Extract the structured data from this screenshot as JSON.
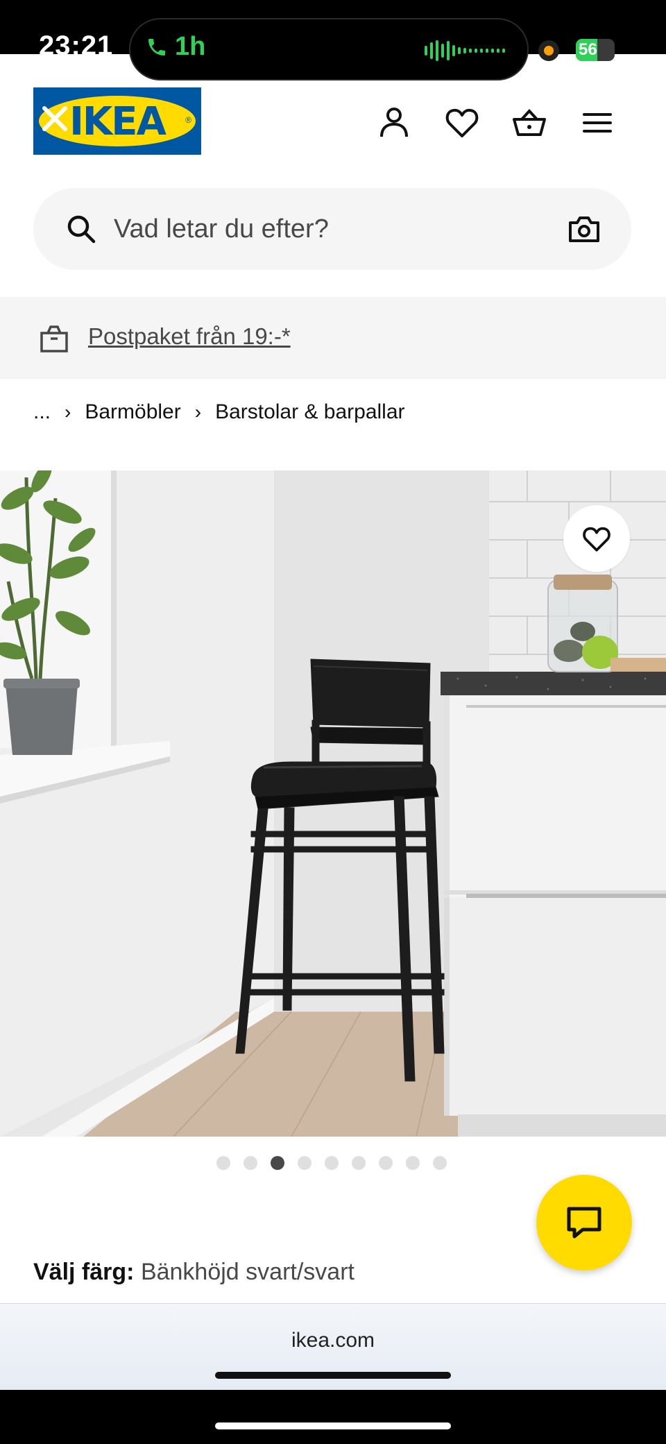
{
  "status_bar": {
    "time": "23:21",
    "call_duration": "1h",
    "battery_level": "56"
  },
  "header": {
    "logo_text": "IKEA"
  },
  "search": {
    "placeholder": "Vad letar du efter?"
  },
  "promo": {
    "text": "Postpaket från 19:-*"
  },
  "breadcrumb": {
    "ellipsis": "...",
    "items": [
      "Barmöbler",
      "Barstolar & barpallar"
    ]
  },
  "carousel": {
    "total": 9,
    "active_index": 2
  },
  "product": {
    "color_label": "Välj färg:",
    "color_value": "Bänkhöjd svart/svart"
  },
  "browser": {
    "url": "ikea.com"
  },
  "colors": {
    "ikea_blue": "#0058a3",
    "ikea_yellow": "#ffdb00",
    "call_green": "#30d158"
  }
}
